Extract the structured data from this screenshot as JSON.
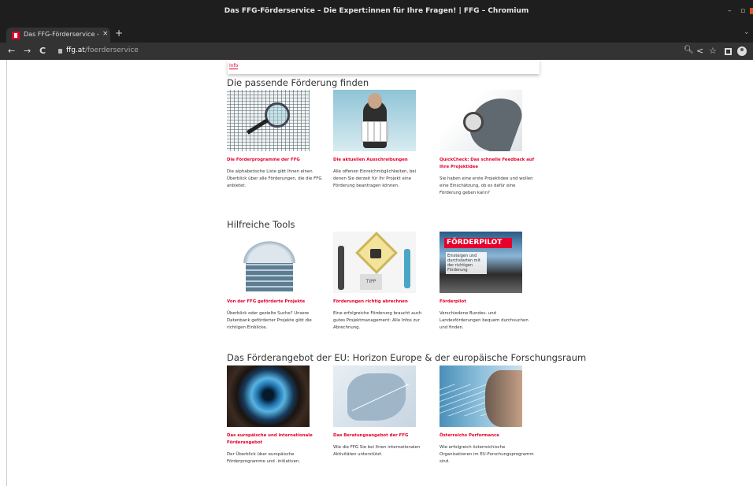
{
  "window": {
    "title": "Das FFG-Förderservice – Die Expert:innen für Ihre Fragen! | FFG – Chromium",
    "minimize": "–",
    "maximize": "▫"
  },
  "tab": {
    "title": "Das FFG-Förderservice - D",
    "close": "×",
    "new_tab": "+"
  },
  "toolbar": {
    "back": "←",
    "forward": "→",
    "reload": "C",
    "url_host": "ffg.at",
    "url_path": "/foerderservice"
  },
  "page": {
    "info_tab": "Info",
    "sections": [
      {
        "heading": "Die passende Förderung finden",
        "cards": [
          {
            "title": "Die Förderprogramme der FFG",
            "desc": "Die alphabetische Liste gibt Ihnen einen Überblick über alle Förderungen, die die FFG anbietet."
          },
          {
            "title": "Die aktuellen Ausschreibungen",
            "desc": "Alle offenen Einreichmöglichkeiten, bei denen Sie derzeit für Ihr Projekt eine Förderung beantragen können."
          },
          {
            "title": "QuickCheck: Das schnelle Feedback auf Ihre Projektidee",
            "desc": "Sie haben eine erste Projektidee und wollen eine Einschätzung, ob es dafür eine Förderung geben kann?"
          }
        ]
      },
      {
        "heading": "Hilfreiche Tools",
        "cards": [
          {
            "title": "Von der FFG geförderte Projekte",
            "desc": "Überblick oder gezielte Suche? Unsere Datenbank geförderter Projekte gibt die richtigen Einblicke."
          },
          {
            "title": "Förderungen richtig abrechnen",
            "desc": "Eine erfolgreiche Förderung braucht auch gutes Projektmanagement: Alle Infos zur Abrechnung."
          },
          {
            "title": "Förderpilot",
            "desc": "Verschiedene Bundes- und Landesförderungen bequem durchsuchen und finden."
          }
        ]
      },
      {
        "heading": "Das Förderangebot der EU: Horizon Europe & der europäische Forschungsraum",
        "cards": [
          {
            "title": "Das europäische und internationale Förderangebot",
            "desc": "Der Überblick über europäische Förderprogramme und -initiativen."
          },
          {
            "title": "Das Beratungsangebot der FFG",
            "desc": "Wie die FFG Sie bei Ihren internationalen Aktivitäten unterstützt."
          },
          {
            "title": "Österreichs Performance",
            "desc": "Wie erfolgreich österreichische Organisationen im EU-Forschungsprogramm sind."
          }
        ]
      }
    ],
    "image_text": {
      "tipp": "TIPP",
      "pilot_brand": "FÖRDERPILOT",
      "pilot_tagline": "Einsteigen und durchstarten mit der richtigen Förderung"
    }
  }
}
